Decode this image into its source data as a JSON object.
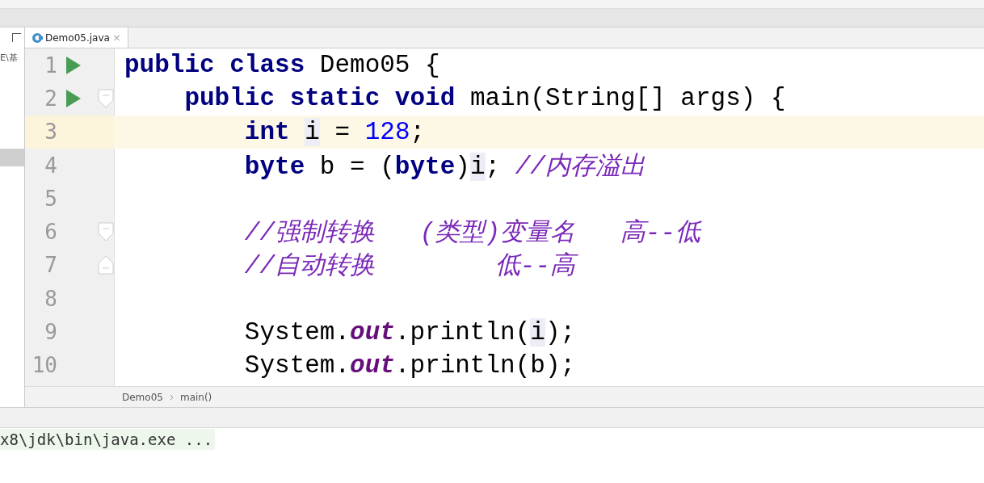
{
  "project_panel": {
    "path_text": "E\\基"
  },
  "tabs": [
    {
      "label": "Demo05.java",
      "selected": true,
      "close_glyph": "×"
    }
  ],
  "editor": {
    "lines": [
      {
        "number": "1",
        "run": true,
        "fold_start": false,
        "fold_end": false,
        "current": false,
        "tokens": [
          {
            "kind": "keyword",
            "text": "public class "
          },
          {
            "kind": "plain",
            "text": "Demo05 {"
          }
        ]
      },
      {
        "number": "2",
        "run": true,
        "fold_start": true,
        "fold_end": false,
        "current": false,
        "tokens": [
          {
            "kind": "keyword",
            "text": "    public static void "
          },
          {
            "kind": "plain",
            "text": "main(String[] args) {"
          }
        ]
      },
      {
        "number": "3",
        "run": false,
        "fold_start": false,
        "fold_end": false,
        "current": true,
        "tokens": [
          {
            "kind": "keyword",
            "text": "        int "
          },
          {
            "kind": "usage",
            "text": "i"
          },
          {
            "kind": "plain",
            "text": " = "
          },
          {
            "kind": "number",
            "text": "128"
          },
          {
            "kind": "plain",
            "text": ";"
          }
        ]
      },
      {
        "number": "4",
        "run": false,
        "fold_start": false,
        "fold_end": false,
        "current": false,
        "tokens": [
          {
            "kind": "keyword",
            "text": "        byte "
          },
          {
            "kind": "plain",
            "text": "b = ("
          },
          {
            "kind": "keyword",
            "text": "byte"
          },
          {
            "kind": "plain",
            "text": ")"
          },
          {
            "kind": "usage",
            "text": "i"
          },
          {
            "kind": "plain",
            "text": "; "
          },
          {
            "kind": "comment",
            "text": "//内存溢出"
          }
        ]
      },
      {
        "number": "5",
        "run": false,
        "fold_start": false,
        "fold_end": false,
        "current": false
      },
      {
        "number": "6",
        "run": false,
        "fold_start": true,
        "fold_end": false,
        "current": false,
        "tokens": [
          {
            "kind": "comment",
            "text": "        //强制转换   (类型)变量名   高--低"
          }
        ]
      },
      {
        "number": "7",
        "run": false,
        "fold_start": false,
        "fold_end": true,
        "current": false,
        "tokens": [
          {
            "kind": "comment",
            "text": "        //自动转换        低--高"
          }
        ]
      },
      {
        "number": "8",
        "run": false,
        "fold_start": false,
        "fold_end": false,
        "current": false
      },
      {
        "number": "9",
        "run": false,
        "fold_start": false,
        "fold_end": false,
        "current": false,
        "tokens": [
          {
            "kind": "plain",
            "text": "        System."
          },
          {
            "kind": "field",
            "text": "out"
          },
          {
            "kind": "plain",
            "text": ".println("
          },
          {
            "kind": "usage",
            "text": "i"
          },
          {
            "kind": "plain",
            "text": ");"
          }
        ]
      },
      {
        "number": "10",
        "run": false,
        "fold_start": false,
        "fold_end": false,
        "current": false,
        "tokens": [
          {
            "kind": "plain",
            "text": "        System."
          },
          {
            "kind": "field",
            "text": "out"
          },
          {
            "kind": "plain",
            "text": ".println(b);"
          }
        ]
      }
    ]
  },
  "breadcrumbs": [
    "Demo05",
    "main()"
  ],
  "console": {
    "command": "x8\\jdk\\bin\\java.exe ..."
  }
}
